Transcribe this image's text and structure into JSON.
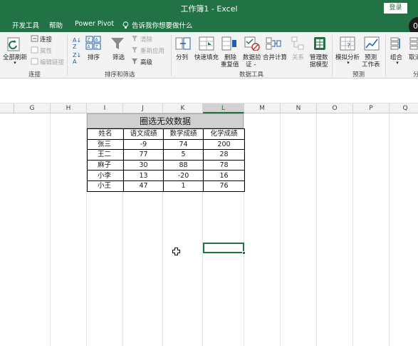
{
  "titlebar": {
    "title": "工作簿1  -  Excel",
    "login": "登录"
  },
  "menu": {
    "tabs": [
      "开发工具",
      "帮助",
      "Power Pivot"
    ],
    "tell_me": "告诉我你想要做什么"
  },
  "ribbon": {
    "connections": {
      "refresh_all": "全部刷新",
      "connections": "连接",
      "properties": "属性",
      "edit_links": "编辑链接",
      "group": "连接"
    },
    "sort_filter": {
      "sort": "排序",
      "filter": "筛选",
      "clear": "清除",
      "reapply": "重新应用",
      "advanced": "高级",
      "group": "排序和筛选"
    },
    "data_tools": {
      "text_to_columns": "分列",
      "flash_fill": "快速填充",
      "remove_duplicates_1": "删除",
      "remove_duplicates_2": "重复值",
      "validation_1": "数据验",
      "validation_2": "证 -",
      "consolidate": "合并计算",
      "relationships": "关系",
      "manage_model_1": "管理数",
      "manage_model_2": "据模型",
      "group": "数据工具"
    },
    "forecast": {
      "what_if": "模拟分析",
      "forecast_sheet_1": "预测",
      "forecast_sheet_2": "工作表",
      "group": "预测"
    },
    "outline": {
      "group_btn": "组合",
      "ungroup_btn": "取消",
      "group": "分"
    }
  },
  "grid": {
    "columns": [
      "G",
      "H",
      "I",
      "J",
      "K",
      "L",
      "M",
      "N",
      "O",
      "P",
      "Q"
    ],
    "selected_column": "L"
  },
  "sheet": {
    "title": "圈选无效数据",
    "headers": [
      "姓名",
      "语文成绩",
      "数学成绩",
      "化学成绩"
    ],
    "rows": [
      [
        "张三",
        "-9",
        "74",
        "200"
      ],
      [
        "王二",
        "77",
        "5",
        "28"
      ],
      [
        "麻子",
        "30",
        "88",
        "78"
      ],
      [
        "小李",
        "13",
        "-20",
        "16"
      ],
      [
        "小王",
        "47",
        "1",
        "76"
      ]
    ]
  },
  "colors": {
    "accent": "#217346",
    "ribbon_bg": "#f3f3f3",
    "title_fill": "#d0d0d0"
  }
}
